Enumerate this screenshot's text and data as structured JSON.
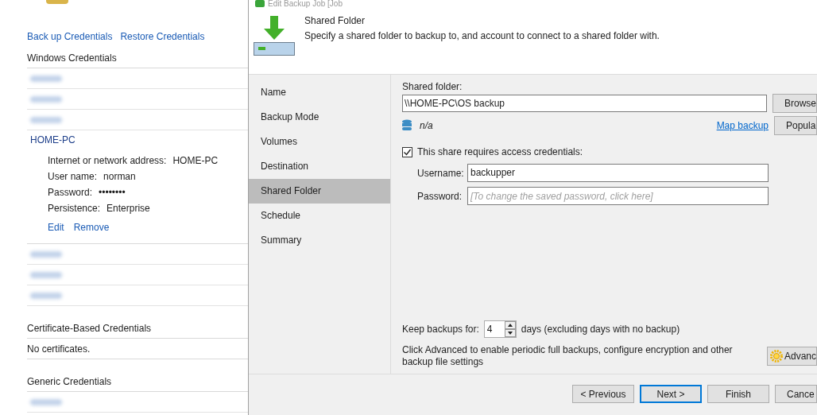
{
  "credential_manager": {
    "links": [
      "Back up Credentials",
      "Restore Credentials"
    ],
    "windows_credentials": {
      "title": "Windows Credentials",
      "entries": [
        {
          "kind": "redacted"
        },
        {
          "kind": "redacted"
        },
        {
          "kind": "redacted"
        },
        {
          "kind": "expanded",
          "name": "HOME-PC",
          "details": [
            {
              "label": "Internet or network address:",
              "value": "HOME-PC"
            },
            {
              "label": "User name:",
              "value": "norman"
            },
            {
              "label": "Password:",
              "value": "••••••••"
            },
            {
              "label": "Persistence:",
              "value": "Enterprise"
            }
          ],
          "actions": [
            "Edit",
            "Remove"
          ]
        },
        {
          "kind": "redacted"
        },
        {
          "kind": "redacted"
        },
        {
          "kind": "redacted"
        }
      ]
    },
    "certificate_credentials": {
      "title": "Certificate-Based Credentials",
      "empty_text": "No certificates."
    },
    "generic_credentials": {
      "title": "Generic Credentials",
      "entries": [
        {
          "kind": "redacted"
        }
      ]
    }
  },
  "dialog": {
    "title": "Edit Backup Job [Job",
    "header": {
      "title": "Shared Folder",
      "description": "Specify a shared folder to backup to, and account to connect to a shared folder with."
    },
    "steps": [
      {
        "label": "Name",
        "selected": false
      },
      {
        "label": "Backup Mode",
        "selected": false
      },
      {
        "label": "Volumes",
        "selected": false
      },
      {
        "label": "Destination",
        "selected": false
      },
      {
        "label": "Shared Folder",
        "selected": true
      },
      {
        "label": "Schedule",
        "selected": false
      },
      {
        "label": "Summary",
        "selected": false
      }
    ],
    "shared_folder": {
      "label": "Shared folder:",
      "value": "\\\\HOME-PC\\OS backup",
      "browse_button": "Browse",
      "size_text": "n/a",
      "map_link": "Map backup",
      "populate_button": "Popula"
    },
    "credentials": {
      "checkbox_label": "This share requires access credentials:",
      "checked": true,
      "username_label": "Username:",
      "username": "backupper",
      "password_label": "Password:",
      "password_placeholder": "[To change the saved password, click here]"
    },
    "retention": {
      "label": "Keep backups for:",
      "value": "4",
      "suffix": "days (excluding days with no backup)"
    },
    "advanced": {
      "text": "Click Advanced to enable periodic full backups, configure encryption and other backup file settings",
      "button": "Advanc"
    },
    "buttons": [
      {
        "label": "< Previous",
        "default": false
      },
      {
        "label": "Next >",
        "default": true
      },
      {
        "label": "Finish",
        "default": false
      },
      {
        "label": "Cance",
        "default": false
      }
    ]
  }
}
